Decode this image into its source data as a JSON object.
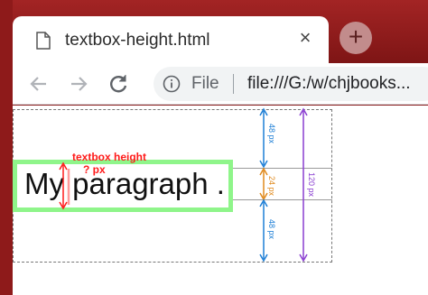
{
  "tab": {
    "title": "textbox-height.html",
    "close_glyph": "×",
    "new_tab_glyph": "+"
  },
  "toolbar": {
    "back_icon": "back-arrow-icon",
    "forward_icon": "forward-arrow-icon",
    "reload_icon": "reload-icon",
    "scheme_label": "File",
    "url": "file:///G:/w/chjbooks..."
  },
  "content": {
    "paragraph_text": "My paragraph .",
    "textbox_label": "textbox height",
    "textbox_value": "? px",
    "measure_top": "48 px",
    "measure_middle": "24 px",
    "measure_bottom": "48 px",
    "measure_total": "120 px"
  },
  "colors": {
    "frame": "#8a1c1c",
    "textbox_border": "#8ff58a",
    "annotation_red": "#ff1a1a",
    "arrow_blue": "#1e7fd6",
    "arrow_orange": "#e08a1e",
    "arrow_purple": "#8a3fd1"
  }
}
